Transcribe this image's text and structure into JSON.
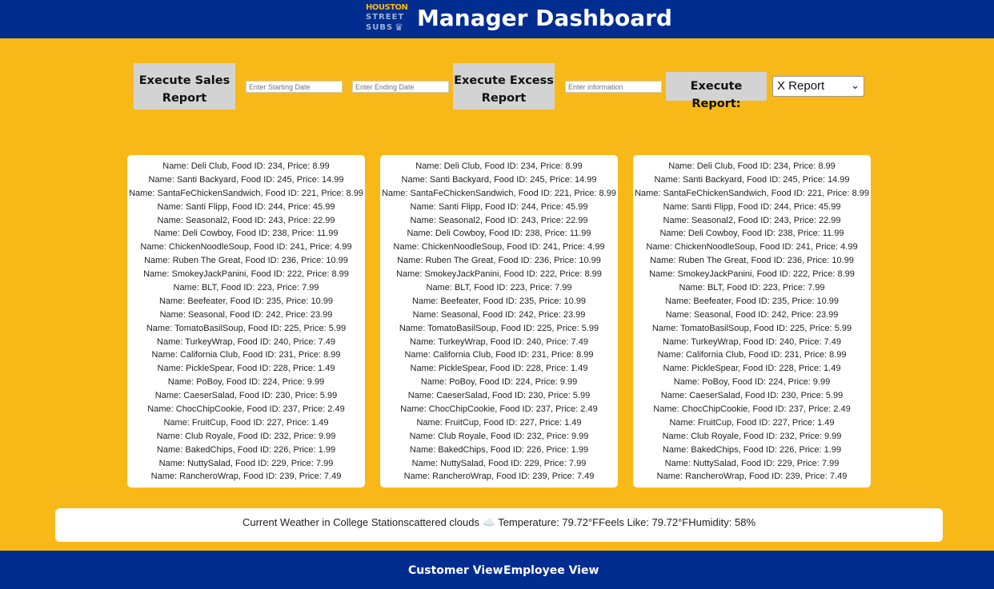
{
  "header": {
    "logo": {
      "line1": "HOUSTON",
      "line2": "STREET",
      "line3": "SUBS",
      "mark": "crown-icon"
    },
    "title": "Manager Dashboard"
  },
  "controls": {
    "sales_button": "Execute Sales Report",
    "start_date_placeholder": "Enter Starting Date",
    "end_date_placeholder": "Enter Ending Date",
    "excess_button": "Execute Excess Report",
    "info_placeholder": "Enter information",
    "report_button": "Execute Report:",
    "report_select": {
      "selected": "X Report"
    }
  },
  "menu_items": [
    "Name: Deli Club, Food ID: 234, Price: 8.99",
    "Name: Santi Backyard, Food ID: 245, Price: 14.99",
    "Name: SantaFeChickenSandwich, Food ID: 221, Price: 8.99",
    "Name: Santi Flipp, Food ID: 244, Price: 45.99",
    "Name: Seasonal2, Food ID: 243, Price: 22.99",
    "Name: Deli Cowboy, Food ID: 238, Price: 11.99",
    "Name: ChickenNoodleSoup, Food ID: 241, Price: 4.99",
    "Name: Ruben The Great, Food ID: 236, Price: 10.99",
    "Name: SmokeyJackPanini, Food ID: 222, Price: 8.99",
    "Name: BLT, Food ID: 223, Price: 7.99",
    "Name: Beefeater, Food ID: 235, Price: 10.99",
    "Name: Seasonal, Food ID: 242, Price: 23.99",
    "Name: TomatoBasilSoup, Food ID: 225, Price: 5.99",
    "Name: TurkeyWrap, Food ID: 240, Price: 7.49",
    "Name: California Club, Food ID: 231, Price: 8.99",
    "Name: PickleSpear, Food ID: 228, Price: 1.49",
    "Name: PoBoy, Food ID: 224, Price: 9.99",
    "Name: CaeserSalad, Food ID: 230, Price: 5.99",
    "Name: ChocChipCookie, Food ID: 237, Price: 2.49",
    "Name: FruitCup, Food ID: 227, Price: 1.49",
    "Name: Club Royale, Food ID: 232, Price: 9.99",
    "Name: BakedChips, Food ID: 226, Price: 1.99",
    "Name: NuttySalad, Food ID: 229, Price: 7.99",
    "Name: RancheroWrap, Food ID: 239, Price: 7.49"
  ],
  "weather": {
    "text": "Current Weather in College Stationscattered clouds",
    "icon": "cloud-icon",
    "icon_glyph": "☁️",
    "details": "Temperature: 79.72°FFeels Like: 79.72°FHumidity: 58%"
  },
  "footer": {
    "customer_link": "Customer View",
    "employee_link": "Employee View"
  },
  "colors": {
    "header_bg": "#002D8F",
    "page_bg": "#F8B818",
    "button_bg": "#D3D3D3"
  }
}
